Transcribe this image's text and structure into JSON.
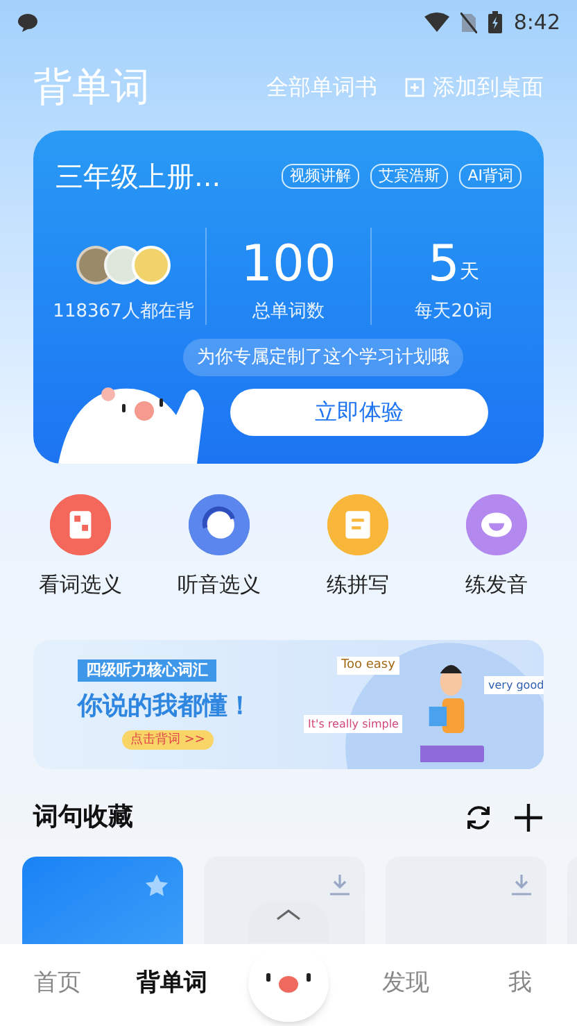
{
  "status_bar": {
    "time": "8:42"
  },
  "header": {
    "title": "背单词",
    "links": [
      "全部单词书",
      "添加到桌面"
    ]
  },
  "plan_card": {
    "book": "三年级上册...",
    "tags": [
      "视频讲解",
      "艾宾浩斯",
      "AI背词"
    ],
    "stats": [
      {
        "kind": "learners",
        "label": "118367人都在背"
      },
      {
        "kind": "number",
        "value": "100",
        "label": "总单词数"
      },
      {
        "kind": "number",
        "value": "5",
        "unit": "天",
        "label": "每天20词"
      }
    ],
    "note": "为你专属定制了这个学习计划哦",
    "button": "立即体验"
  },
  "modes": [
    {
      "kind": "look",
      "label": "看词选义",
      "color": "#f4675b"
    },
    {
      "kind": "listen",
      "label": "听音选义",
      "color": "#5a86ee"
    },
    {
      "kind": "spell",
      "label": "练拼写",
      "color": "#f8b63a"
    },
    {
      "kind": "speak",
      "label": "练发音",
      "color": "#b489ef"
    }
  ],
  "banner": {
    "tag": "四级听力核心词汇",
    "headline": "你说的我都懂！",
    "action": "点击背词 >>",
    "bubbles": [
      "Too easy",
      "very good",
      "It's really simple"
    ]
  },
  "collection": {
    "title": "词句收藏",
    "cards": [
      {
        "kind": "favorite"
      },
      {
        "kind": "download"
      },
      {
        "kind": "download"
      },
      {
        "kind": "plain"
      }
    ]
  },
  "tabs": [
    {
      "kind": "text",
      "label": "首页",
      "selected": false
    },
    {
      "kind": "text",
      "label": "背单词",
      "selected": true
    },
    {
      "kind": "mascot",
      "selected": false
    },
    {
      "kind": "text",
      "label": "发现",
      "selected": false
    },
    {
      "kind": "text",
      "label": "我",
      "selected": false
    }
  ]
}
